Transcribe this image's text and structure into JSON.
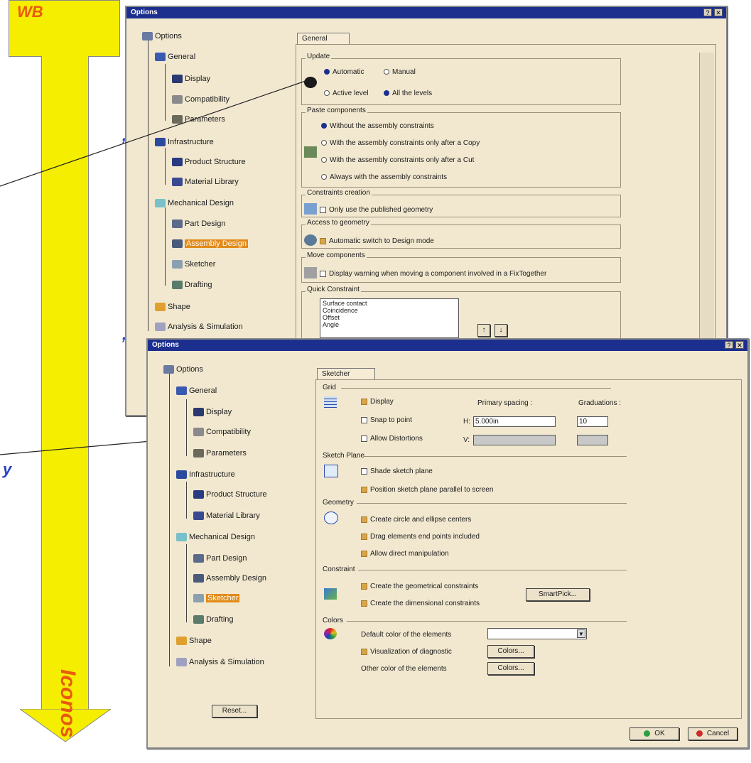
{
  "arrow": {
    "top_label": "WB",
    "bottom_label": "Iconos",
    "color": "#f5ee00",
    "label_color": "#e85a10"
  },
  "side_fragments": [
    ",",
    ",",
    "y"
  ],
  "window1": {
    "title": "Options",
    "tab": "General",
    "tree": [
      {
        "label": "Options"
      },
      {
        "label": "General"
      },
      {
        "label": "Display"
      },
      {
        "label": "Compatibility"
      },
      {
        "label": "Parameters"
      },
      {
        "label": "Infrastructure"
      },
      {
        "label": "Product Structure"
      },
      {
        "label": "Material Library"
      },
      {
        "label": "Mechanical Design"
      },
      {
        "label": "Part Design"
      },
      {
        "label": "Assembly Design"
      },
      {
        "label": "Sketcher"
      },
      {
        "label": "Drafting"
      },
      {
        "label": "Shape"
      },
      {
        "label": "Analysis & Simulation"
      }
    ],
    "groups": {
      "update": "Update",
      "update_opts": [
        "Automatic",
        "Manual",
        "Active level",
        "All the levels"
      ],
      "paste": "Paste components",
      "paste_opts": [
        "Without the assembly constraints",
        "With the assembly constraints only after a Copy",
        "With the assembly constraints only after a Cut",
        "Always with the assembly constraints"
      ],
      "constraints": "Constraints creation",
      "constraints_opt": "Only use the published geometry",
      "access": "Access to geometry",
      "access_opt": "Automatic switch to Design mode",
      "move": "Move components",
      "move_opt": "Display warning when moving a component involved in a FixTogether",
      "quick": "Quick Constraint",
      "quick_list": [
        "Surface contact",
        "Coincidence",
        "Offset",
        "Angle"
      ]
    }
  },
  "window2": {
    "title": "Options",
    "tab": "Sketcher",
    "tree": [
      {
        "label": "Options"
      },
      {
        "label": "General"
      },
      {
        "label": "Display"
      },
      {
        "label": "Compatibility"
      },
      {
        "label": "Parameters"
      },
      {
        "label": "Infrastructure"
      },
      {
        "label": "Product Structure"
      },
      {
        "label": "Material Library"
      },
      {
        "label": "Mechanical Design"
      },
      {
        "label": "Part Design"
      },
      {
        "label": "Assembly Design"
      },
      {
        "label": "Sketcher"
      },
      {
        "label": "Drafting"
      },
      {
        "label": "Shape"
      },
      {
        "label": "Analysis & Simulation"
      }
    ],
    "grid": {
      "title": "Grid",
      "display": "Display",
      "snap": "Snap to point",
      "allow": "Allow Distortions",
      "primary": "Primary spacing :",
      "graduations": "Graduations :",
      "h_label": "H:",
      "v_label": "V:",
      "h_value": "5.000in",
      "h_grad": "10"
    },
    "sketch_plane": {
      "title": "Sketch Plane",
      "shade": "Shade sketch plane",
      "position": "Position sketch plane parallel to screen"
    },
    "geometry": {
      "title": "Geometry",
      "o1": "Create circle and ellipse centers",
      "o2": "Drag elements end points included",
      "o3": "Allow direct manipulation"
    },
    "constraint": {
      "title": "Constraint",
      "o1": "Create the geometrical constraints",
      "o2": "Create the dimensional constraints",
      "smartpick": "SmartPick..."
    },
    "colors": {
      "title": "Colors",
      "default": "Default color of the elements",
      "visual": "Visualization of diagnostic",
      "other": "Other color of the elements",
      "btn": "Colors..."
    },
    "reset": "Reset...",
    "ok": "OK",
    "cancel": "Cancel"
  }
}
